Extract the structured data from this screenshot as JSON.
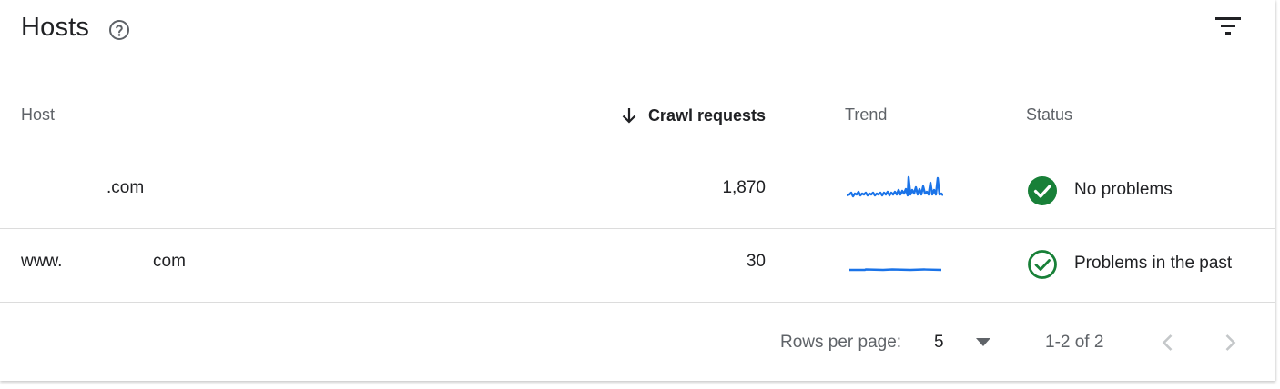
{
  "card": {
    "title": "Hosts",
    "help_icon": "help-circle-icon",
    "filter_icon": "filter-list-icon"
  },
  "table": {
    "columns": {
      "host": "Host",
      "crawl_requests": "Crawl requests",
      "trend": "Trend",
      "status": "Status"
    },
    "sort": {
      "column": "crawl_requests",
      "direction": "descending",
      "icon": "arrow-down-icon"
    },
    "rows": [
      {
        "host_prefix": "",
        "host_suffix": ".com",
        "crawl_requests": "1,870",
        "trend_color": "#1a73e8",
        "status_icon": "check-circle-filled-icon",
        "status": "No problems"
      },
      {
        "host_prefix": "www.",
        "host_suffix": "com",
        "crawl_requests": "30",
        "trend_color": "#1a73e8",
        "status_icon": "check-circle-outline-icon",
        "status": "Problems in the past"
      }
    ]
  },
  "pagination": {
    "rows_per_page_label": "Rows per page:",
    "rows_per_page_value": "5",
    "range": "1-2 of 2",
    "prev_icon": "chevron-left-icon",
    "next_icon": "chevron-right-icon"
  },
  "colors": {
    "status_green": "#188038",
    "trend_blue": "#1a73e8",
    "text_primary": "#202124",
    "text_secondary": "#5f6368"
  }
}
